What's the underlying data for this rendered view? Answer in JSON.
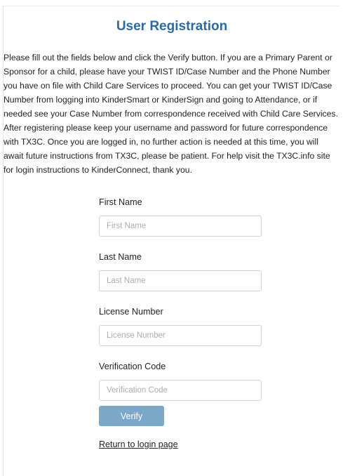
{
  "page": {
    "title": "User Registration",
    "intro": "Please fill out the fields below and click the Verify button. If you are a Primary Parent or Sponsor for a child, please have your TWIST ID/Case Number and the Phone Number you have on file with Child Care Services to proceed. You can get your TWIST ID/Case Number from logging into KinderSmart or KinderSign and going to Attendance, or if needed see your Case Number from correspondence received with Child Care Services. After registering please keep your username and password for future correspondence with TX3C. Once you are logged in, no further action is needed at this time, you will await future instructions from TX3C, please be patient. For help visit the TX3C.info site for login instructions to KinderConnect, thank you."
  },
  "form": {
    "first_name": {
      "label": "First Name",
      "placeholder": "First Name",
      "value": ""
    },
    "last_name": {
      "label": "Last Name",
      "placeholder": "Last Name",
      "value": ""
    },
    "license_number": {
      "label": "License Number",
      "placeholder": "License Number",
      "value": ""
    },
    "verification_code": {
      "label": "Verification Code",
      "placeholder": "Verification Code",
      "value": ""
    },
    "verify_label": "Verify",
    "return_link": "Return to login page"
  },
  "colors": {
    "title": "#2b6aa3",
    "button": "#7ba7c9"
  }
}
